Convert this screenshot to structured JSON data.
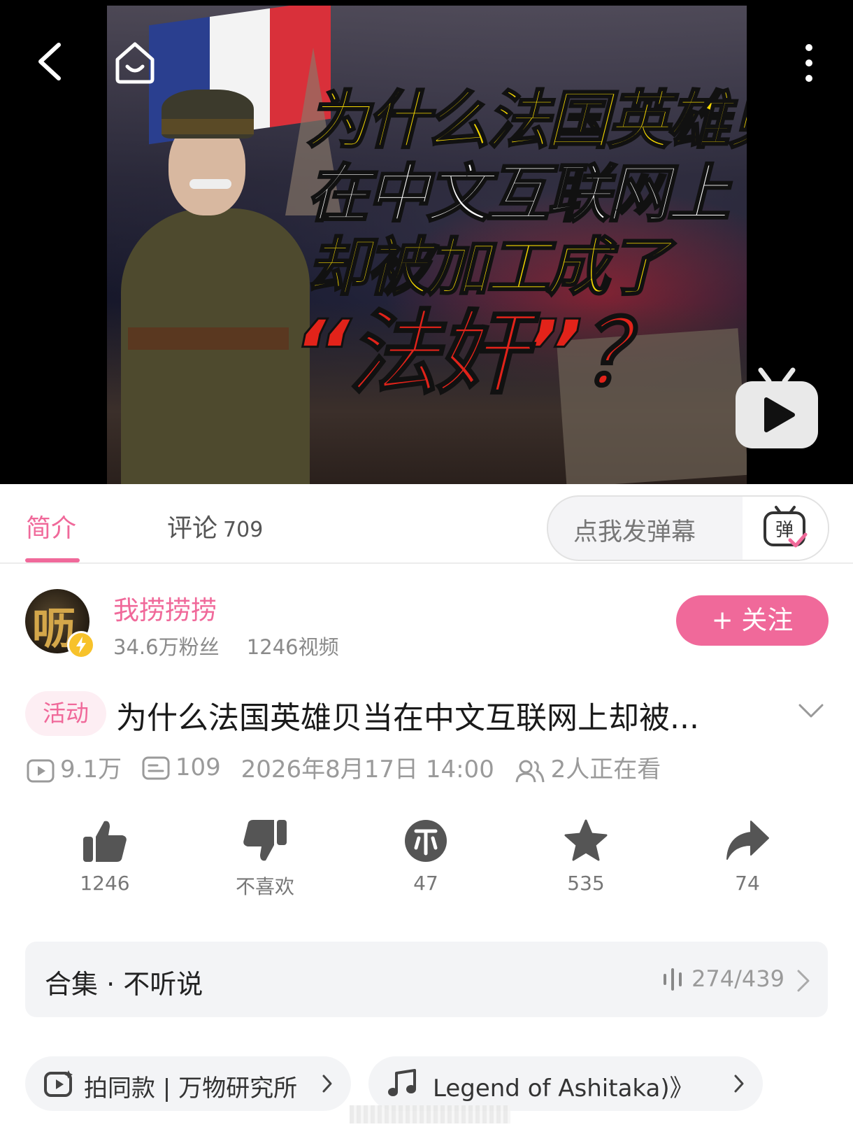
{
  "player": {
    "thumbnail_title_lines": [
      "为什么法国英雄贝当",
      "在中文互联网上",
      "却被加工成了",
      "“法奸”？"
    ],
    "icons": [
      "back-arrow-icon",
      "home-icon",
      "more-vertical-icon",
      "tv-play-icon"
    ]
  },
  "tabs": {
    "intro": "简介",
    "comments": "评论",
    "comments_count": "709",
    "danmaku_placeholder": "点我发弹幕",
    "danmaku_icon_char": "弹"
  },
  "uploader": {
    "name": "我捞捞捞",
    "fans": "34.6万粉丝",
    "videos": "1246视频",
    "avatar_char": "呖",
    "follow_label": "+ 关注"
  },
  "video": {
    "tag": "活动",
    "title": "为什么法国英雄贝当在中文互联网上却被...",
    "views": "9.1万",
    "danmaku_count": "109",
    "datetime": "2026年8月17日 14:00",
    "watching": "2人正在看"
  },
  "actions": {
    "like": "1246",
    "dislike": "不喜欢",
    "coin": "47",
    "favorite": "535",
    "share": "74"
  },
  "collection": {
    "title": "合集 · 不听说",
    "progress": "274/439"
  },
  "chips": {
    "template": "拍同款 | 万物研究所",
    "music": "Legend of Ashitaka)》"
  },
  "colors": {
    "accent": "#f0699a",
    "text_gray": "#9a9a9a",
    "icon_gray": "#555555"
  }
}
